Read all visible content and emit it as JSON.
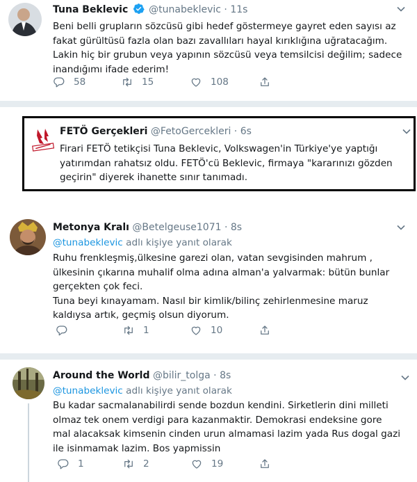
{
  "tweets": [
    {
      "name": "Tuna Beklevic",
      "handle": "@tunabeklevic",
      "time": "11s",
      "verified": true,
      "text": "Beni belli grupların sözcüsü gibi hedef göstermeye gayret eden sayısı az fakat gürültüsü fazla olan bazı zavallıları hayal kırıklığına uğratacağım. Lakin hiç bir grubun veya yapının sözcüsü veya temsilcisi değilim; sadece inandığımı ifade ederim!",
      "replies": "58",
      "retweets": "15",
      "likes": "108"
    },
    {
      "name": "FETÖ Gerçekleri",
      "handle": "@FetoGercekleri",
      "time": "6s",
      "text": "Firari FETÖ tetikçisi Tuna Beklevic, Volkswagen'in Türkiye'ye yaptığı yatırımdan rahatsız oldu. FETÖ'cü Beklevic, firmaya \"kararınızı gözden geçirin\" diyerek ihanette sınır tanımadı."
    },
    {
      "name": "Metonya Kralı",
      "handle": "@Betelgeuse1071",
      "time": "8s",
      "reply_mention": "@tunabeklevic",
      "reply_suffix": "adlı kişiye yanıt olarak",
      "text": "Ruhu frenkleşmiş,ülkesine garezi olan, vatan sevgisinden mahrum , ülkesinin çıkarına muhalif olma adına alman'a yalvarmak: bütün bunlar gerçekten çok feci.\nTuna beyi kınayamam. Nasıl bir kimlik/bilinç zehirlenmesine maruz kaldıysa artık, geçmiş olsun diyorum.",
      "replies": "",
      "retweets": "1",
      "likes": "10"
    },
    {
      "name": "Around the World",
      "handle": "@bilir_tolga",
      "time": "8s",
      "reply_mention": "@tunabeklevic",
      "reply_suffix": "adlı kişiye yanıt olarak",
      "text": "Bu kadar sacmalanabilirdi sende bozdun kendini. Sirketlerin dini milleti olmaz tek onem verdigi para kazanmaktir. Demokrasi endeksine gore mal alacaksak kimsenin cinden urun almamasi lazim yada Rus dogal gazi ile isinmamak lazim. Bos yapmissin",
      "replies": "1",
      "retweets": "2",
      "likes": "19"
    }
  ],
  "dot": "·",
  "colors": {
    "verified": "#1da1f2",
    "mention": "#1b95e0",
    "muted": "#657786",
    "separator": "#e6ecf0",
    "highlight_border": "#000000"
  },
  "icons": [
    "verified-badge-icon",
    "chevron-down-icon",
    "reply-icon",
    "retweet-icon",
    "like-icon",
    "share-icon"
  ]
}
